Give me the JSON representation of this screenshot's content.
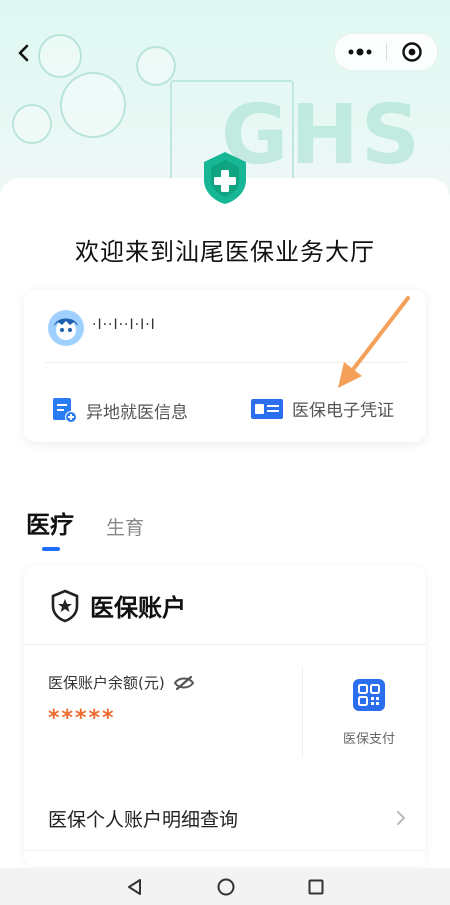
{
  "app": {
    "welcome": "欢迎来到汕尾医保业务大厅"
  },
  "user": {
    "name": "·I··I··I·I·I"
  },
  "quick_actions": [
    {
      "label": "异地就医信息",
      "icon": "document-plus-icon"
    },
    {
      "label": "医保电子凭证",
      "icon": "id-card-icon"
    }
  ],
  "tabs": [
    {
      "label": "医疗",
      "active": true
    },
    {
      "label": "生育",
      "active": false
    }
  ],
  "account": {
    "title": "医保账户",
    "balance_label": "医保账户余额(元)",
    "balance_value": "*****",
    "pay_label": "医保支付",
    "detail_label": "医保个人账户明细查询"
  },
  "hero_text": "GHS",
  "colors": {
    "accent": "#1f6fff",
    "brand": "#17b694",
    "balance": "#ef6b2f",
    "annotation": "#f5a05a"
  }
}
